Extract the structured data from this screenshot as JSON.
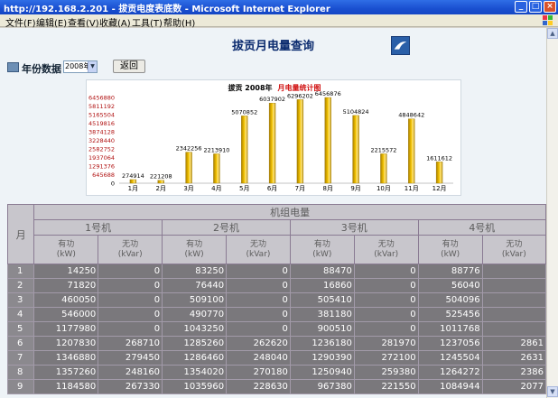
{
  "window": {
    "title": "http://192.168.2.201 - 拔贡电度表底数 - Microsoft Internet Explorer",
    "buttons": {
      "min": "_",
      "max": "□",
      "close": "×"
    }
  },
  "menu": [
    "文件(F)",
    "编辑(E)",
    "查看(V)",
    "收藏(A)",
    "工具(T)",
    "帮助(H)"
  ],
  "page": {
    "title": "拔贡月电量查询",
    "year_label": "年份数据",
    "year_value": "2008年",
    "back_label": "返回"
  },
  "chart_data": {
    "type": "bar",
    "title_left": "拔贡 2008年",
    "title_right": "月电量统计图",
    "categories": [
      "1月",
      "2月",
      "3月",
      "4月",
      "5月",
      "6月",
      "7月",
      "8月",
      "9月",
      "10月",
      "11月",
      "12月"
    ],
    "values": [
      274914,
      221208,
      2342256,
      2213910,
      5070852,
      6037902,
      6296202,
      6456876,
      5104824,
      2215572,
      4848642,
      1611612
    ],
    "value_labels": [
      "274914",
      "221208",
      "2342256",
      "2213910",
      "5070852",
      "6037902",
      "6296202",
      "6456876",
      "5104824",
      "2215572",
      "4848642",
      "1611612"
    ],
    "y_ticks": [
      "0",
      "645688",
      "1291376",
      "1937064",
      "2582752",
      "3228440",
      "3874128",
      "4519816",
      "5165504",
      "5811192",
      "6456880"
    ],
    "ylim": [
      0,
      6456880
    ],
    "bar_color": "#f2c200"
  },
  "table": {
    "month_header": "月",
    "group_header": "机组电量",
    "units": [
      "1号机",
      "2号机",
      "3号机",
      "4号机"
    ],
    "active": "有功",
    "active_unit": "(kW)",
    "reactive": "无功",
    "reactive_unit": "(kVar)",
    "rows": [
      [
        "1",
        "14250",
        "0",
        "83250",
        "0",
        "88470",
        "0",
        "88776",
        ""
      ],
      [
        "2",
        "71820",
        "0",
        "76440",
        "0",
        "16860",
        "0",
        "56040",
        ""
      ],
      [
        "3",
        "460050",
        "0",
        "509100",
        "0",
        "505410",
        "0",
        "504096",
        ""
      ],
      [
        "4",
        "546000",
        "0",
        "490770",
        "0",
        "381180",
        "0",
        "525456",
        ""
      ],
      [
        "5",
        "1177980",
        "0",
        "1043250",
        "0",
        "900510",
        "0",
        "1011768",
        ""
      ],
      [
        "6",
        "1207830",
        "268710",
        "1285260",
        "262620",
        "1236180",
        "281970",
        "1237056",
        "2861"
      ],
      [
        "7",
        "1346880",
        "279450",
        "1286460",
        "248040",
        "1290390",
        "272100",
        "1245504",
        "2631"
      ],
      [
        "8",
        "1357260",
        "248160",
        "1354020",
        "270180",
        "1250940",
        "259380",
        "1264272",
        "2386"
      ],
      [
        "9",
        "1184580",
        "267330",
        "1035960",
        "228630",
        "967380",
        "221550",
        "1084944",
        "2077"
      ]
    ]
  }
}
